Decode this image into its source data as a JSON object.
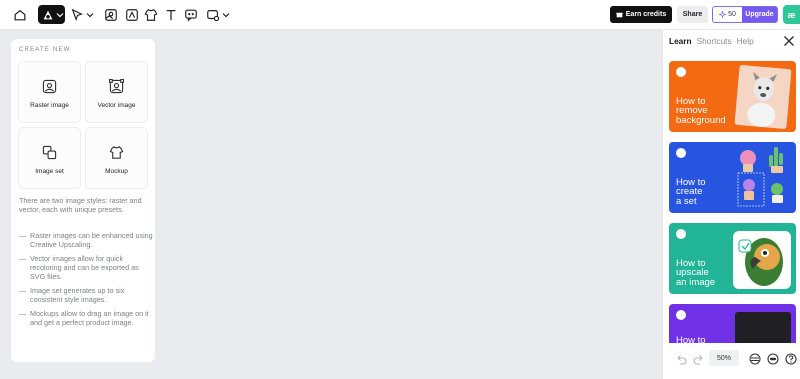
{
  "toolbar": {
    "earn_credits_label": "Earn credits",
    "share_label": "Share",
    "credits_count": "50",
    "upgrade_label": "Upgrade",
    "user_badge": "æ",
    "icons": [
      "home-icon",
      "logo-icon",
      "select-tool-icon",
      "image-icon",
      "vector-icon",
      "mockup-icon",
      "text-icon",
      "chat-icon",
      "image-settings-icon"
    ]
  },
  "create_panel": {
    "title": "CREATE NEW",
    "tiles": [
      {
        "label": "Raster image",
        "icon": "raster-image-icon"
      },
      {
        "label": "Vector image",
        "icon": "vector-image-icon"
      },
      {
        "label": "Image set",
        "icon": "image-set-icon"
      },
      {
        "label": "Mockup",
        "icon": "tshirt-icon"
      }
    ],
    "description": "There are two image styles: raster and vector, each with unique presets.",
    "bullets": [
      "Raster images can be enhanced using Creative Upscaling.",
      "Vector images allow for quick recoloring and can be exported as SVG files.",
      "Image set generates up to six consistent style images.",
      "Mockups allow to drag an image on it and get a perfect product image."
    ]
  },
  "learn_panel": {
    "tabs": [
      "Learn",
      "Shortcuts",
      "Help"
    ],
    "active_tab": "Learn",
    "cards": [
      {
        "title": "How to\nremove\nbackground",
        "color": "#f46a12"
      },
      {
        "title": "How to\ncreate\na set",
        "color": "#2755e0"
      },
      {
        "title": "How to\nupscale\nan image",
        "color": "#22b496"
      },
      {
        "title": "How to",
        "color": "#7030e6"
      }
    ],
    "zoom_label": "50%"
  },
  "colors": {
    "accent": "#7659ee",
    "canvas": "#e9ebee",
    "dark": "#111111"
  }
}
